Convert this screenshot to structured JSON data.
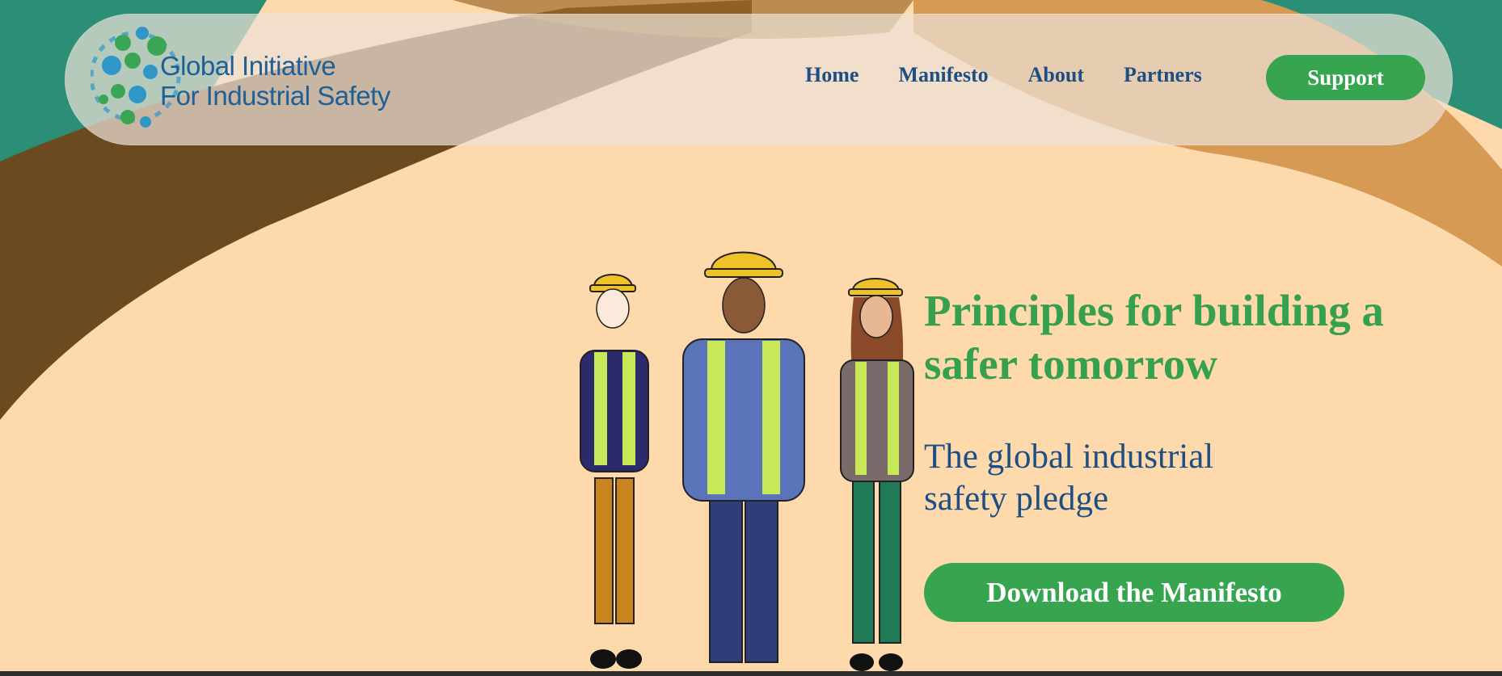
{
  "brand": {
    "line1": "Global Initiative",
    "line2": "For Industrial Safety",
    "logo_icon": "globe-dots-logo"
  },
  "nav": {
    "items": [
      "Home",
      "Manifesto",
      "About",
      "Partners"
    ],
    "support_label": "Support"
  },
  "hero": {
    "title": "Principles for building a safer tomorrow",
    "subtitle_line1": "The global industrial",
    "subtitle_line2": "safety pledge",
    "cta_label": "Download the Manifesto",
    "illustration": "three-workers-in-hard-hats-and-safety-vests"
  },
  "colors": {
    "accent_green": "#37a54f",
    "brand_blue": "#1d4f84",
    "background_peach": "#fdd9ab",
    "band_brown": "#6b4a1f",
    "band_teal": "#2b8f78",
    "band_tan": "#d79a54"
  }
}
